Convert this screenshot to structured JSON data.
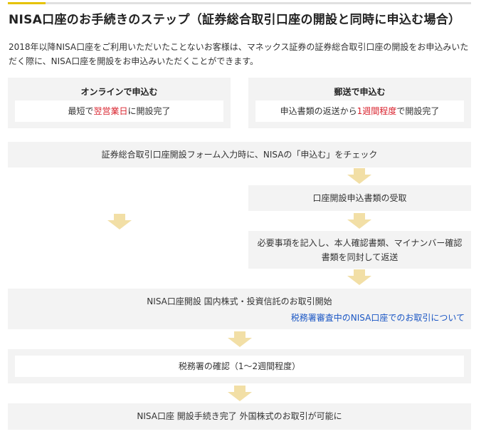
{
  "title": "NISA口座のお手続きのステップ（証券総合取引口座の開設と同時に申込む場合）",
  "intro": "2018年以降NISA口座をご利用いただいたことないお客様は、マネックス証券の証券総合取引口座の開設をお申込みいただく際に、NISA口座を開設をお申込みいただくことができます。",
  "colors": {
    "accent": "#e6c200",
    "arrow": "#f2dfa6",
    "box_bg": "#f3f3f3",
    "highlight": "#d9232e",
    "link": "#1a56c4"
  },
  "online": {
    "heading": "オンラインで申込む",
    "text_before": "最短で",
    "text_highlight": "翌営業日",
    "text_after": "に開設完了"
  },
  "mail": {
    "heading": "郵送で申込む",
    "text_before": "申込書類の返送から",
    "text_highlight": "1週間程度",
    "text_after": "で開設完了"
  },
  "steps": {
    "form_check": "証券総合取引口座開設フォーム入力時に、NISAの「申込む」をチェック",
    "receive_docs": "口座開設申込書類の受取",
    "return_docs": "必要事項を記入し、本人確認書類、マイナンバー確認書類を同封して返送",
    "nisa_open": "NISA口座開設 国内株式・投資信託のお取引開始",
    "nisa_link": "税務署審査中のNISA口座でのお取引について",
    "tax_office": "税務署の確認（1〜2週間程度）",
    "complete": "NISA口座 開設手続き完了 外国株式のお取引が可能に"
  }
}
